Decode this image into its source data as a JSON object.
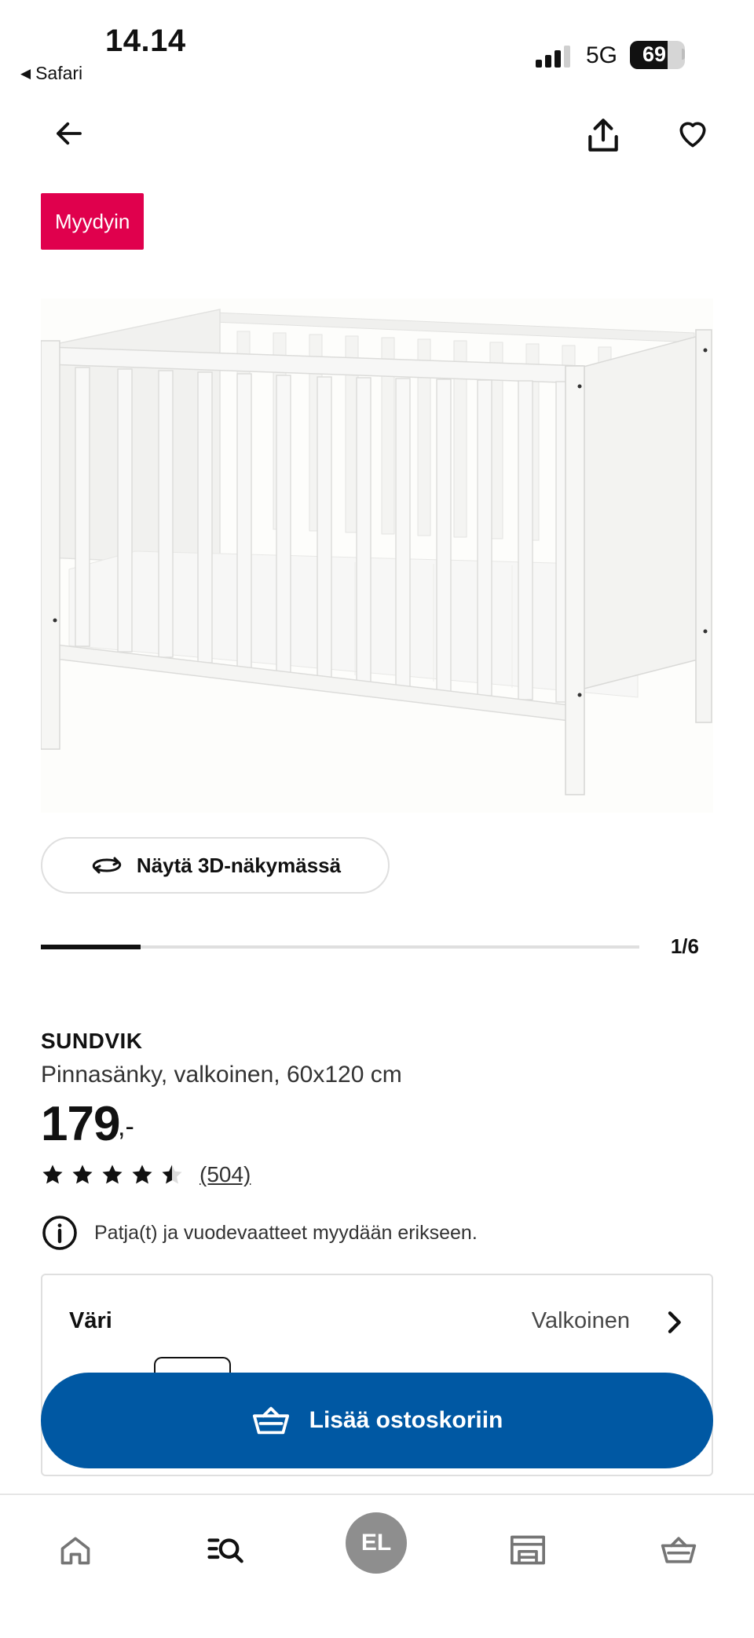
{
  "status_bar": {
    "time": "14.14",
    "back_app": "Safari",
    "network": "5G",
    "battery_percent": "69",
    "battery_level": 0.69
  },
  "header": {
    "back_icon": "arrow-left-icon",
    "share_icon": "share-icon",
    "favorite_icon": "heart-icon"
  },
  "badge": {
    "label": "Myydyin",
    "color": "#e0004d"
  },
  "gallery": {
    "image_alt": "white crib product photo",
    "view_3d_label": "Näytä 3D-näkymässä",
    "counter": "1/6",
    "progress": 0.1667
  },
  "product": {
    "name": "SUNDVIK",
    "description": "Pinnasänky, valkoinen, 60x120 cm",
    "price": "179",
    "price_suffix": ",-",
    "rating": 4.5,
    "rating_max": 5,
    "review_count": "(504)",
    "notice": "Patja(t) ja vuodevaatteet myydään erikseen."
  },
  "color_selector": {
    "label": "Väri",
    "value": "Valkoinen"
  },
  "cart_button": {
    "label": "Lisää ostoskoriin",
    "color": "#0058a3"
  },
  "tab_bar": {
    "home_icon": "home-icon",
    "search_icon": "search-icon",
    "avatar_initials": "EL",
    "store_icon": "store-icon",
    "cart_icon": "cart-icon"
  }
}
